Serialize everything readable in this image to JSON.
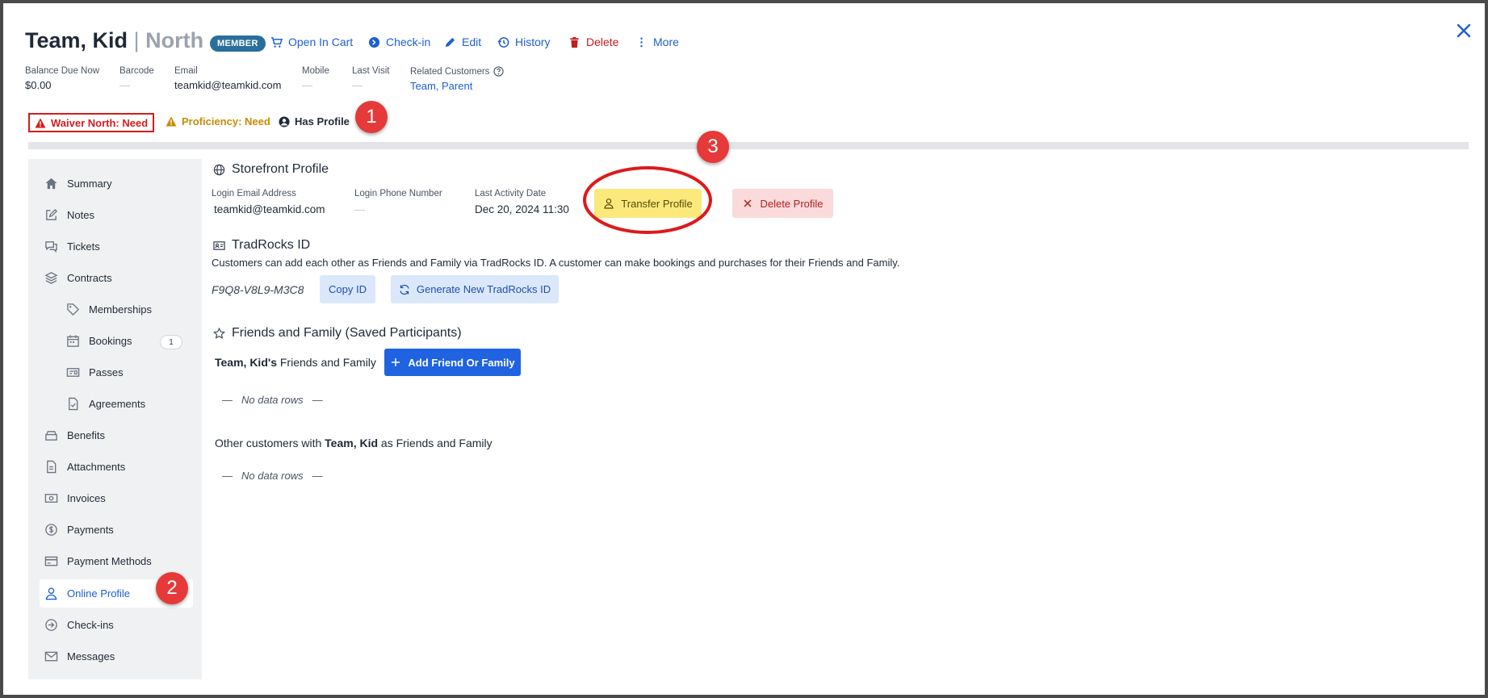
{
  "header": {
    "name": "Team, Kid",
    "separator": "|",
    "location": "North",
    "badge": "MEMBER",
    "actions": {
      "open_in_cart": "Open In Cart",
      "check_in": "Check-in",
      "edit": "Edit",
      "history": "History",
      "delete": "Delete",
      "more": "More"
    }
  },
  "info": {
    "balance": {
      "label": "Balance Due Now",
      "value": "$0.00"
    },
    "barcode": {
      "label": "Barcode",
      "value": "—"
    },
    "email": {
      "label": "Email",
      "value": "teamkid@teamkid.com"
    },
    "mobile": {
      "label": "Mobile",
      "value": "—"
    },
    "last_visit": {
      "label": "Last Visit",
      "value": "—"
    },
    "related": {
      "label": "Related Customers",
      "value": "Team, Parent"
    }
  },
  "status": {
    "waiver": "Waiver North: Need",
    "proficiency": "Proficiency: Need",
    "has_profile": "Has Profile"
  },
  "markers": {
    "m1": "1",
    "m2": "2",
    "m3": "3"
  },
  "sidebar": {
    "items": [
      {
        "label": "Summary",
        "icon": "home-icon"
      },
      {
        "label": "Notes",
        "icon": "pencil-icon"
      },
      {
        "label": "Tickets",
        "icon": "chat-icon"
      },
      {
        "label": "Contracts",
        "icon": "layers-icon"
      },
      {
        "label": "Memberships",
        "icon": "tag-icon"
      },
      {
        "label": "Bookings",
        "icon": "calendar-icon"
      },
      {
        "label": "Passes",
        "icon": "ticket-icon"
      },
      {
        "label": "Agreements",
        "icon": "document-check-icon"
      },
      {
        "label": "Benefits",
        "icon": "box-icon"
      },
      {
        "label": "Attachments",
        "icon": "file-icon"
      },
      {
        "label": "Invoices",
        "icon": "cash-icon"
      },
      {
        "label": "Payments",
        "icon": "dollar-icon"
      },
      {
        "label": "Payment Methods",
        "icon": "credit-card-icon"
      },
      {
        "label": "Online Profile",
        "icon": "user-icon"
      },
      {
        "label": "Check-ins",
        "icon": "arrow-circle-icon"
      },
      {
        "label": "Messages",
        "icon": "envelope-icon"
      }
    ],
    "bookings_count": "1"
  },
  "storefront": {
    "title": "Storefront Profile",
    "login_email_label": "Login Email Address",
    "login_email_value": "teamkid@teamkid.com",
    "login_phone_label": "Login Phone Number",
    "login_phone_value": "—",
    "last_activity_label": "Last Activity Date",
    "last_activity_value": "Dec 20, 2024 11:30",
    "transfer_button": "Transfer Profile",
    "delete_button": "Delete Profile"
  },
  "tradrocks": {
    "title": "TradRocks ID",
    "description": "Customers can add each other as Friends and Family via TradRocks ID. A customer can make bookings and purchases for their Friends and Family.",
    "id_value": "F9Q8-V8L9-M3C8",
    "copy_button": "Copy ID",
    "generate_button": "Generate New TradRocks ID"
  },
  "friends": {
    "title": "Friends and Family (Saved Participants)",
    "owner_name": "Team, Kid's",
    "owner_suffix": "Friends and Family",
    "add_button": "Add Friend Or Family",
    "no_data_1": "No data rows",
    "other_prefix": "Other customers with",
    "other_name": "Team, Kid",
    "other_suffix": "as Friends and Family",
    "no_data_2": "No data rows",
    "dash": "—"
  }
}
